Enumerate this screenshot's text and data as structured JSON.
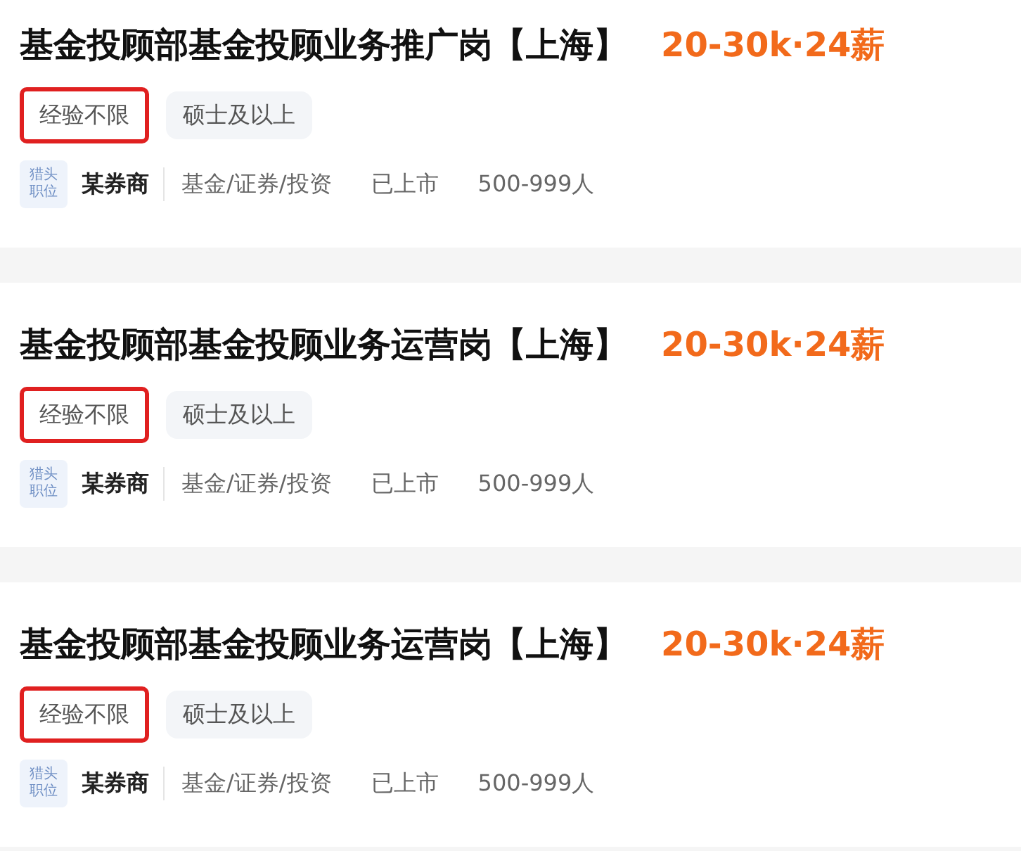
{
  "jobs": [
    {
      "title": "基金投顾部基金投顾业务推广岗【上海】",
      "salary": "20-30k·24薪",
      "tags": [
        {
          "label": "经验不限",
          "highlighted": true
        },
        {
          "label": "硕士及以上",
          "highlighted": false
        }
      ],
      "logo_text": [
        "猎头",
        "职位"
      ],
      "company": "某券商",
      "details": [
        "基金/证券/投资",
        "已上市",
        "500-999人"
      ]
    },
    {
      "title": "基金投顾部基金投顾业务运营岗【上海】",
      "salary": "20-30k·24薪",
      "tags": [
        {
          "label": "经验不限",
          "highlighted": true
        },
        {
          "label": "硕士及以上",
          "highlighted": false
        }
      ],
      "logo_text": [
        "猎头",
        "职位"
      ],
      "company": "某券商",
      "details": [
        "基金/证券/投资",
        "已上市",
        "500-999人"
      ]
    },
    {
      "title": "基金投顾部基金投顾业务运营岗【上海】",
      "salary": "20-30k·24薪",
      "tags": [
        {
          "label": "经验不限",
          "highlighted": true
        },
        {
          "label": "硕士及以上",
          "highlighted": false
        }
      ],
      "logo_text": [
        "猎头",
        "职位"
      ],
      "company": "某券商",
      "details": [
        "基金/证券/投资",
        "已上市",
        "500-999人"
      ]
    }
  ]
}
